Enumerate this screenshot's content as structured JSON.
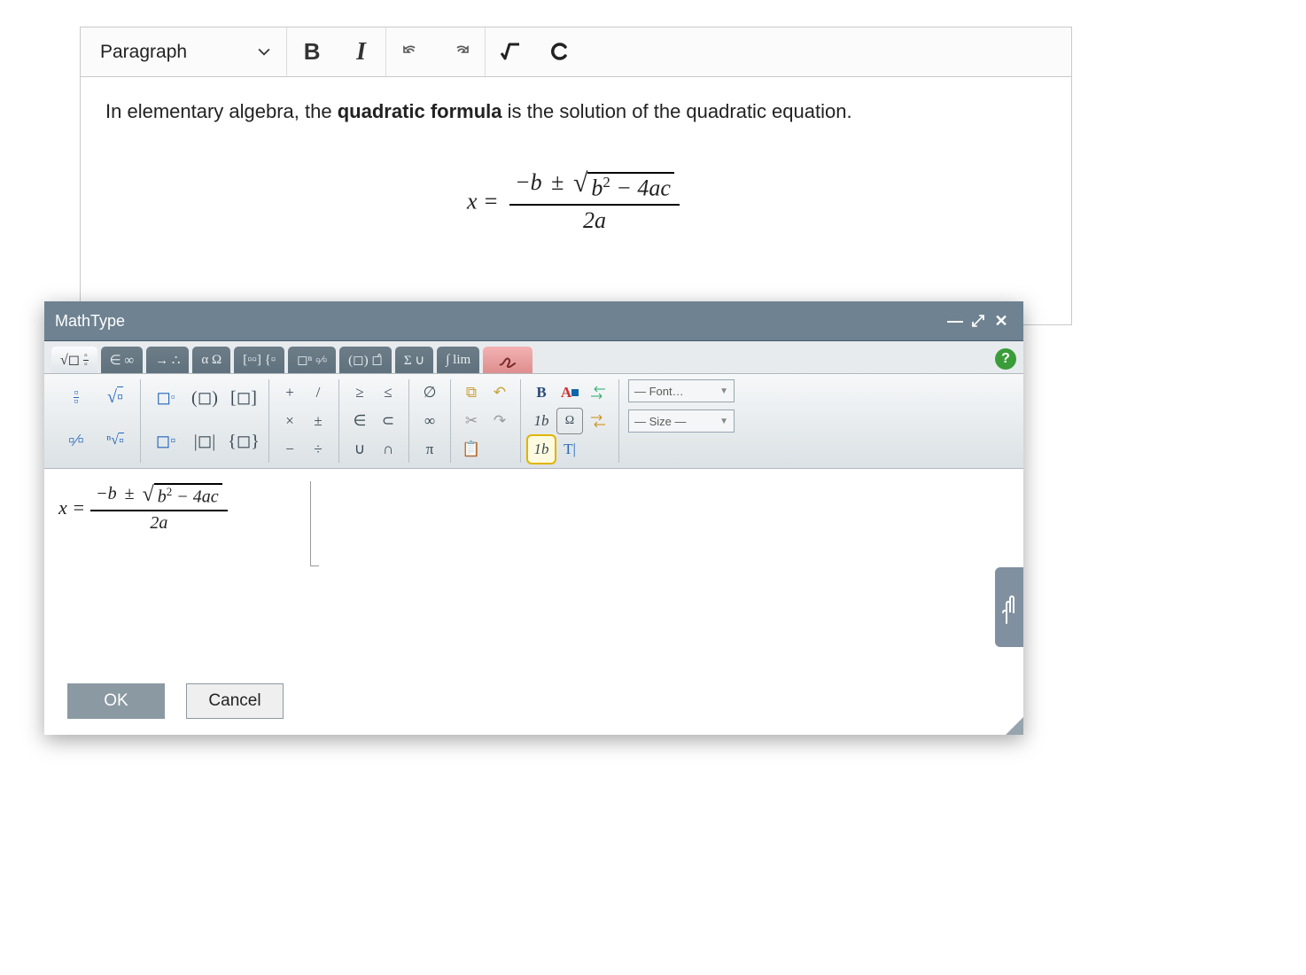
{
  "toolbar": {
    "block_format": "Paragraph",
    "bold_label": "B",
    "italic_label": "I"
  },
  "content": {
    "text_before": "In elementary algebra, the ",
    "bold_phrase": "quadratic formula",
    "text_after": " is the solution of the quadratic equation.",
    "formula": {
      "lhs": "x =",
      "numerator_a": "−b",
      "pm": "±",
      "radicand": "b",
      "radicand_exp": "2",
      "radicand_tail": " − 4ac",
      "denominator": "2a"
    }
  },
  "dialog": {
    "title": "MathType",
    "ok": "OK",
    "cancel": "Cancel",
    "font_dd": "— Font…",
    "size_dd": "— Size —",
    "help": "?",
    "tabs": {
      "t1a": "√◻",
      "t1b": "◻⁄◻",
      "t2": "∈ ∞",
      "t3": "→ ∴",
      "t4": "α Ω",
      "t5": "[▫▫] {▫",
      "t6": "◻ⁿ ▫⁄▫",
      "t7": "(◻) ◻̂",
      "t8": "Σ ∪",
      "t9": "∫ lim"
    },
    "palette": {
      "g1": {
        "a": "◻⁄◻",
        "b": "√◻",
        "c": "◻⁄◻",
        "d": "ⁿ√◻"
      },
      "g2": {
        "a": "◻ⁿ",
        "b": "◻ₙ",
        "c": "(◻)",
        "d": "|◻|",
        "e": "[◻]",
        "f": "{◻}"
      },
      "g3": {
        "a": "+",
        "b": "/",
        "c": "×",
        "d": "±",
        "e": "−",
        "f": "÷"
      },
      "g4": {
        "a": "≥",
        "b": "≤",
        "c": "∈",
        "d": "⊂",
        "e": "∪",
        "f": "∩"
      },
      "g5": {
        "a": "∅",
        "b": "∞",
        "c": "π"
      },
      "g6": {
        "a": "📋",
        "b": "↶",
        "c": "✂",
        "d": "↷",
        "e": "📄"
      },
      "g7": {
        "a": "B",
        "b": "A",
        "c": "1b",
        "d": "Ω",
        "e": "1b",
        "f": "T|"
      },
      "g8": {
        "a": "rtl",
        "b": "ltr"
      }
    },
    "formula": {
      "lhs": "x =",
      "numerator_a": "−b",
      "pm": "±",
      "radicand": "b",
      "radicand_exp": "2",
      "radicand_tail": " − 4ac",
      "denominator": "2a"
    }
  }
}
